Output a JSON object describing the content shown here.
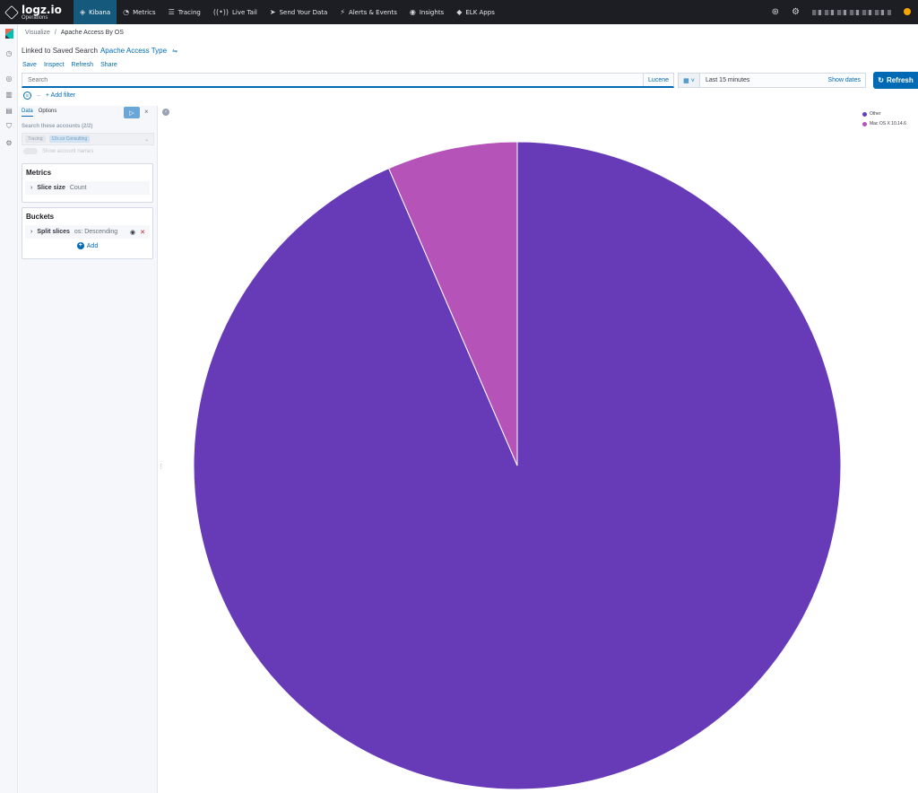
{
  "topnav": {
    "logo_name": "logz.io",
    "logo_sub": "Operations",
    "items": [
      {
        "label": "Kibana",
        "icon": "kibana-icon",
        "active": true
      },
      {
        "label": "Metrics",
        "icon": "metrics-icon"
      },
      {
        "label": "Tracing",
        "icon": "tracing-icon"
      },
      {
        "label": "Live Tail",
        "icon": "live-tail-icon"
      },
      {
        "label": "Send Your Data",
        "icon": "send-icon"
      },
      {
        "label": "Alerts & Events",
        "icon": "alerts-icon"
      },
      {
        "label": "Insights",
        "icon": "eye-icon"
      },
      {
        "label": "ELK Apps",
        "icon": "apps-icon"
      }
    ]
  },
  "breadcrumb": {
    "root": "Visualize",
    "current": "Apache Access By OS"
  },
  "linked": {
    "prefix": "Linked to Saved Search",
    "link": "Apache Access Type"
  },
  "actions": [
    "Save",
    "Inspect",
    "Refresh",
    "Share"
  ],
  "search": {
    "placeholder": "Search",
    "language": "Lucene"
  },
  "date": {
    "value": "Last 15 minutes",
    "show_dates": "Show dates"
  },
  "refresh_label": "Refresh",
  "filter": {
    "add_label": "+ Add filter"
  },
  "editor": {
    "tabs": [
      "Data",
      "Options"
    ],
    "accounts_label": "Search these accounts (2/2)",
    "account_pills": [
      "Tracing",
      "12x.co Consulting"
    ],
    "show_account_names": "Show account names",
    "metrics_title": "Metrics",
    "metric": {
      "name": "Slice size",
      "sub": "Count"
    },
    "buckets_title": "Buckets",
    "bucket": {
      "name": "Split slices",
      "sub": "os: Descending"
    },
    "add_label": "Add"
  },
  "colors": {
    "other": "#673ab7",
    "mac": "#b553b8",
    "accent": "#006bb4"
  },
  "chart_data": {
    "type": "pie",
    "categories": [
      "Other",
      "Mac OS X 10.14.6"
    ],
    "values": [
      93.5,
      6.5
    ],
    "colors": [
      "#673ab7",
      "#b553b8"
    ],
    "legend_position": "top-right"
  }
}
